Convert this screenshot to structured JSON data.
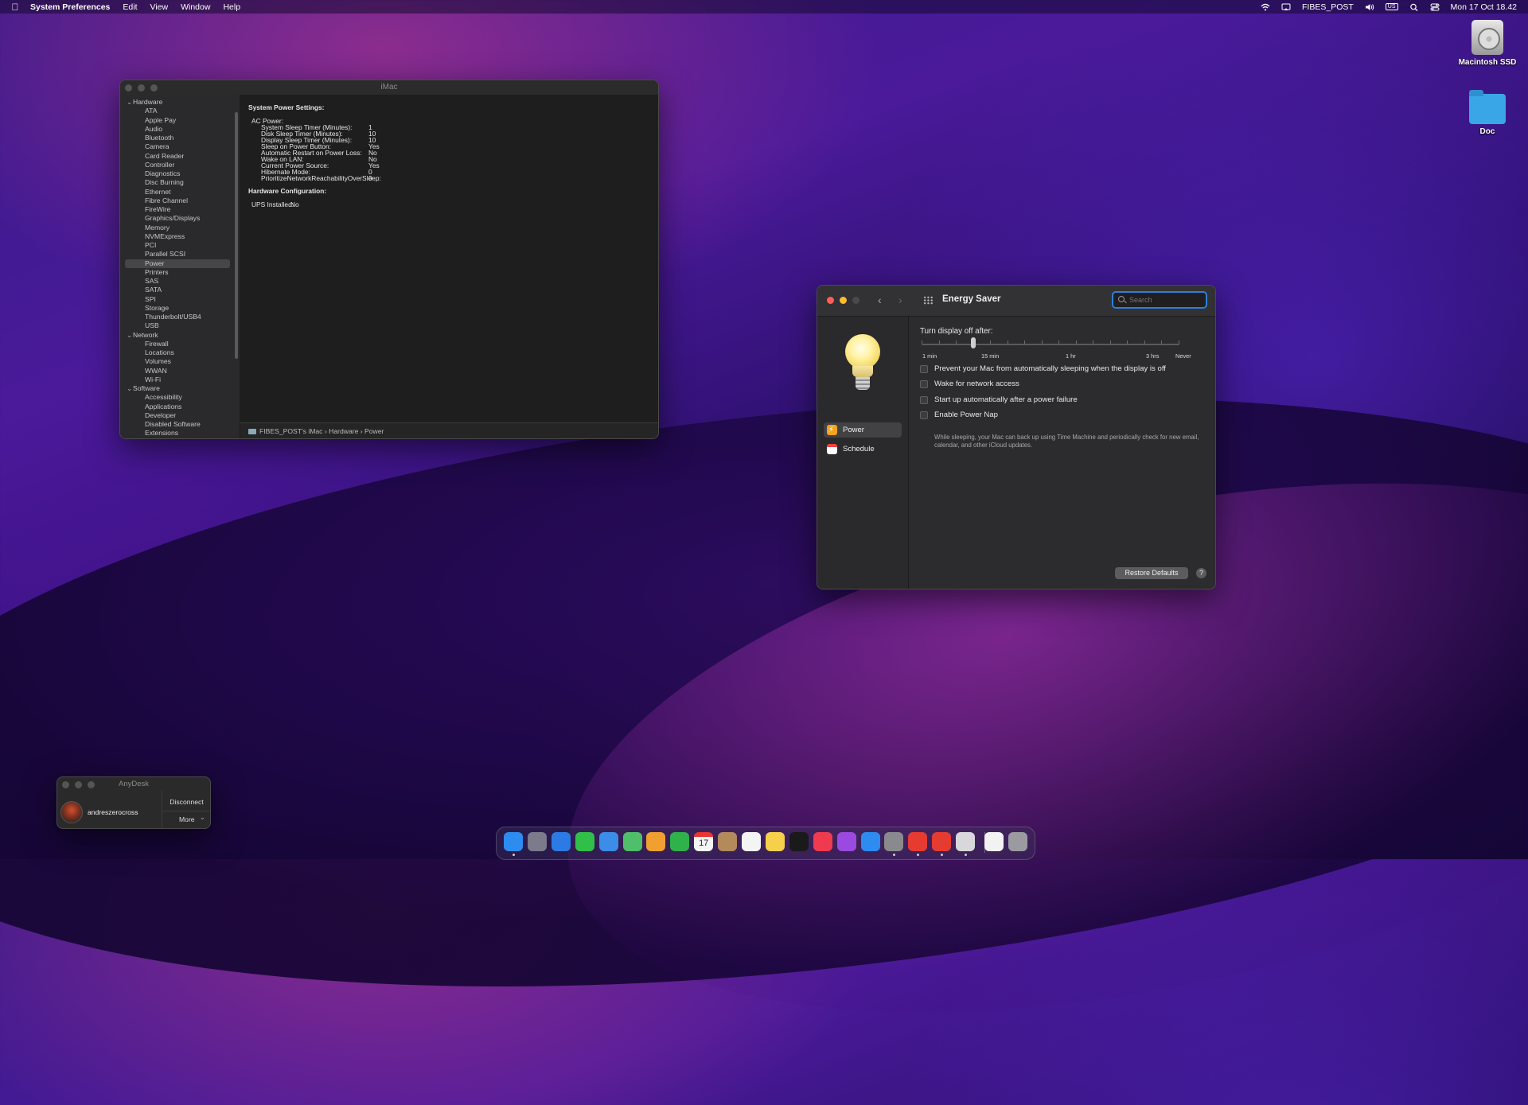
{
  "menubar": {
    "apple": "",
    "app_name": "System Preferences",
    "menus": [
      "Edit",
      "View",
      "Window",
      "Help"
    ],
    "user": "FIBES_POST",
    "input_source": "US",
    "clock": "Mon 17 Oct  18.42"
  },
  "desktop": {
    "items": [
      "Macintosh SSD",
      "Doc"
    ]
  },
  "sysinfo": {
    "title": "iMac",
    "tree": [
      {
        "type": "group",
        "label": "Hardware"
      },
      {
        "type": "leaf",
        "label": "ATA"
      },
      {
        "type": "leaf",
        "label": "Apple Pay"
      },
      {
        "type": "leaf",
        "label": "Audio"
      },
      {
        "type": "leaf",
        "label": "Bluetooth"
      },
      {
        "type": "leaf",
        "label": "Camera"
      },
      {
        "type": "leaf",
        "label": "Card Reader"
      },
      {
        "type": "leaf",
        "label": "Controller"
      },
      {
        "type": "leaf",
        "label": "Diagnostics"
      },
      {
        "type": "leaf",
        "label": "Disc Burning"
      },
      {
        "type": "leaf",
        "label": "Ethernet"
      },
      {
        "type": "leaf",
        "label": "Fibre Channel"
      },
      {
        "type": "leaf",
        "label": "FireWire"
      },
      {
        "type": "leaf",
        "label": "Graphics/Displays"
      },
      {
        "type": "leaf",
        "label": "Memory"
      },
      {
        "type": "leaf",
        "label": "NVMExpress"
      },
      {
        "type": "leaf",
        "label": "PCI"
      },
      {
        "type": "leaf",
        "label": "Parallel SCSI"
      },
      {
        "type": "leaf",
        "label": "Power",
        "selected": true
      },
      {
        "type": "leaf",
        "label": "Printers"
      },
      {
        "type": "leaf",
        "label": "SAS"
      },
      {
        "type": "leaf",
        "label": "SATA"
      },
      {
        "type": "leaf",
        "label": "SPI"
      },
      {
        "type": "leaf",
        "label": "Storage"
      },
      {
        "type": "leaf",
        "label": "Thunderbolt/USB4"
      },
      {
        "type": "leaf",
        "label": "USB"
      },
      {
        "type": "group",
        "label": "Network"
      },
      {
        "type": "leaf",
        "label": "Firewall"
      },
      {
        "type": "leaf",
        "label": "Locations"
      },
      {
        "type": "leaf",
        "label": "Volumes"
      },
      {
        "type": "leaf",
        "label": "WWAN"
      },
      {
        "type": "leaf",
        "label": "Wi-Fi"
      },
      {
        "type": "group",
        "label": "Software"
      },
      {
        "type": "leaf",
        "label": "Accessibility"
      },
      {
        "type": "leaf",
        "label": "Applications"
      },
      {
        "type": "leaf",
        "label": "Developer"
      },
      {
        "type": "leaf",
        "label": "Disabled Software"
      },
      {
        "type": "leaf",
        "label": "Extensions"
      }
    ],
    "detail": {
      "heading1": "System Power Settings:",
      "ac_power": "AC Power:",
      "settings": [
        {
          "key": "System Sleep Timer (Minutes):",
          "value": "1"
        },
        {
          "key": "Disk Sleep Timer (Minutes):",
          "value": "10"
        },
        {
          "key": "Display Sleep Timer (Minutes):",
          "value": "10"
        },
        {
          "key": "Sleep on Power Button:",
          "value": "Yes"
        },
        {
          "key": "Automatic Restart on Power Loss:",
          "value": "No"
        },
        {
          "key": "Wake on LAN:",
          "value": "No"
        },
        {
          "key": "Current Power Source:",
          "value": "Yes"
        },
        {
          "key": "Hibernate Mode:",
          "value": "0"
        },
        {
          "key": "PrioritizeNetworkReachabilityOverSleep:",
          "value": "0"
        }
      ],
      "heading2": "Hardware Configuration:",
      "ups_key": "UPS Installed:",
      "ups_value": "No"
    },
    "pathbar": [
      "FIBES_POST's iMac",
      "Hardware",
      "Power"
    ]
  },
  "energy": {
    "title": "Energy Saver",
    "search_placeholder": "Search",
    "sidebar": [
      {
        "label": "Power",
        "selected": true
      },
      {
        "label": "Schedule",
        "selected": false
      }
    ],
    "slider": {
      "label": "Turn display off after:",
      "ticks": [
        "1 min",
        "15 min",
        "1 hr",
        "3 hrs",
        "Never"
      ],
      "value": "15 min"
    },
    "options": [
      {
        "label": "Prevent your Mac from automatically sleeping when the display is off",
        "checked": false
      },
      {
        "label": "Wake for network access",
        "checked": false
      },
      {
        "label": "Start up automatically after a power failure",
        "checked": false
      },
      {
        "label": "Enable Power Nap",
        "checked": false
      }
    ],
    "power_nap_note": "While sleeping, your Mac can back up using Time Machine and periodically check for new email, calendar, and other iCloud updates.",
    "restore_label": "Restore Defaults",
    "help_label": "?"
  },
  "anydesk": {
    "title": "AnyDesk",
    "user": "andreszerocross",
    "disconnect": "Disconnect",
    "more": "More"
  },
  "dock": {
    "apps": [
      {
        "name": "finder",
        "color": "#2d8cf0",
        "running": true
      },
      {
        "name": "launchpad",
        "color": "#7b7b8c",
        "running": false
      },
      {
        "name": "safari",
        "color": "#2c7be5",
        "running": false
      },
      {
        "name": "messages",
        "color": "#30c04a",
        "running": false
      },
      {
        "name": "mail",
        "color": "#3b8de8",
        "running": false
      },
      {
        "name": "maps",
        "color": "#4fbf6a",
        "running": false
      },
      {
        "name": "photos",
        "color": "#f0a030",
        "running": false
      },
      {
        "name": "facetime",
        "color": "#2fb24a",
        "running": false
      },
      {
        "name": "calendar",
        "color": "#f4f4f4",
        "running": false
      },
      {
        "name": "contacts",
        "color": "#b38a5a",
        "running": false
      },
      {
        "name": "reminders",
        "color": "#f4f4f4",
        "running": false
      },
      {
        "name": "notes",
        "color": "#f6d04a",
        "running": false
      },
      {
        "name": "tv",
        "color": "#1a1a1a",
        "running": false
      },
      {
        "name": "music",
        "color": "#f03a4e",
        "running": false
      },
      {
        "name": "podcasts",
        "color": "#9a4ae0",
        "running": false
      },
      {
        "name": "app-store",
        "color": "#2c8cf0",
        "running": false
      },
      {
        "name": "system-preferences",
        "color": "#8a8a8e",
        "running": true
      },
      {
        "name": "anydesk",
        "color": "#e63b30",
        "running": true
      },
      {
        "name": "anydesk-2",
        "color": "#e63b30",
        "running": true
      },
      {
        "name": "preview",
        "color": "#d8d8dc",
        "running": true
      },
      {
        "name": "document",
        "color": "#f2f2f2",
        "running": false
      },
      {
        "name": "trash",
        "color": "#9a9aa0",
        "running": false
      }
    ],
    "calendar_day": "17"
  }
}
